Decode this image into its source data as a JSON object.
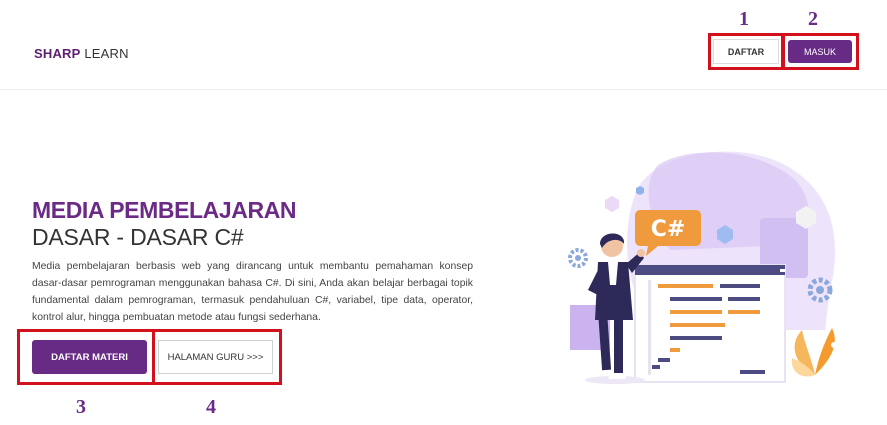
{
  "brand": {
    "part1": "SHARP",
    "part2": "LEARN"
  },
  "nav": {
    "register_label": "DAFTAR",
    "login_label": "MASUK"
  },
  "hero": {
    "title_line1": "MEDIA PEMBELAJARAN",
    "title_line2": "DASAR - DASAR C#",
    "description": "Media pembelajaran berbasis web yang dirancang untuk membantu pemahaman konsep dasar-dasar pemrograman menggunakan bahasa C#. Di sini, Anda akan belajar berbagai topik fundamental dalam pemrograman, termasuk pendahuluan C#, variabel, tipe data, operator, kontrol alur, hingga pembuatan metode atau fungsi sederhana.",
    "primary_button": "DAFTAR MATERI",
    "secondary_button": "HALAMAN GURU >>>"
  },
  "illustration": {
    "badge_text": "C#"
  },
  "annotations": {
    "n1": "1",
    "n2": "2",
    "n3": "3",
    "n4": "4"
  },
  "colors": {
    "brand_purple": "#672a85",
    "highlight_red": "#d3111d",
    "accent_orange": "#f09a3e"
  }
}
